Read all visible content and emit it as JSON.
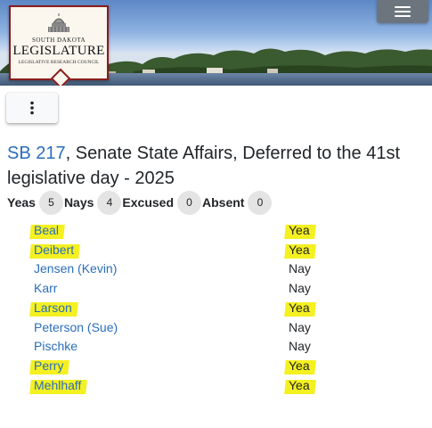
{
  "header": {
    "logo": {
      "state": "SOUTH DAKOTA",
      "name": "LEGISLATURE",
      "subtitle": "LEGISLATIVE RESEARCH COUNCIL"
    },
    "menu_icon": "hamburger-icon"
  },
  "toolbar": {
    "more_icon": "kebab-vertical-icon"
  },
  "bill": {
    "number": "SB 217",
    "description": ", Senate State Affairs, Deferred to the 41st legislative day - 2025"
  },
  "tally": [
    {
      "label": "Yeas",
      "count": "5"
    },
    {
      "label": "Nays",
      "count": "4"
    },
    {
      "label": "Excused",
      "count": "0"
    },
    {
      "label": "Absent",
      "count": "0"
    }
  ],
  "votes": [
    {
      "name": "Beal",
      "vote": "Yea",
      "highlighted": true
    },
    {
      "name": "Deibert",
      "vote": "Yea",
      "highlighted": true
    },
    {
      "name": "Jensen (Kevin)",
      "vote": "Nay",
      "highlighted": false
    },
    {
      "name": "Karr",
      "vote": "Nay",
      "highlighted": false
    },
    {
      "name": "Larson",
      "vote": "Yea",
      "highlighted": true
    },
    {
      "name": "Peterson (Sue)",
      "vote": "Nay",
      "highlighted": false
    },
    {
      "name": "Pischke",
      "vote": "Nay",
      "highlighted": false
    },
    {
      "name": "Perry",
      "vote": "Yea",
      "highlighted": true
    },
    {
      "name": "Mehlhaff",
      "vote": "Yea",
      "highlighted": true
    }
  ],
  "colors": {
    "link": "#2a6ebb",
    "highlight": "#f5f020",
    "badge": "#e4e4e4",
    "menu_button": "#6c757d"
  }
}
